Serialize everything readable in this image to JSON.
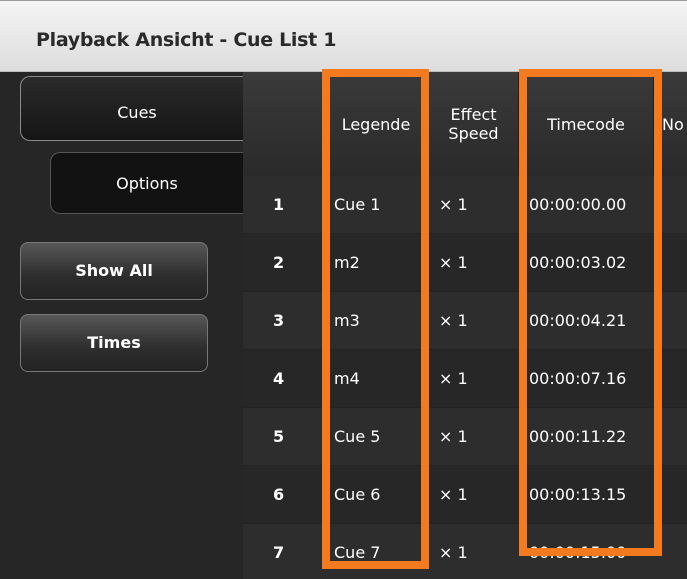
{
  "window": {
    "title": "Playback Ansicht - Cue List 1"
  },
  "left_panel": {
    "tabs": [
      {
        "label": "Cues"
      },
      {
        "label": "Options"
      }
    ],
    "buttons": [
      {
        "label": "Show All"
      },
      {
        "label": "Times"
      }
    ]
  },
  "table": {
    "headers": {
      "number": "",
      "legende": "Legende",
      "effect_speed": "Effect Speed",
      "timecode": "Timecode",
      "next": "No"
    },
    "rows": [
      {
        "num": "1",
        "legende": "Cue 1",
        "speed": "× 1",
        "timecode": "00:00:00.00"
      },
      {
        "num": "2",
        "legende": "m2",
        "speed": "× 1",
        "timecode": "00:00:03.02"
      },
      {
        "num": "3",
        "legende": "m3",
        "speed": "× 1",
        "timecode": "00:00:04.21"
      },
      {
        "num": "4",
        "legende": "m4",
        "speed": "× 1",
        "timecode": "00:00:07.16"
      },
      {
        "num": "5",
        "legende": "Cue 5",
        "speed": "× 1",
        "timecode": "00:00:11.22"
      },
      {
        "num": "6",
        "legende": "Cue 6",
        "speed": "× 1",
        "timecode": "00:00:13.15"
      },
      {
        "num": "7",
        "legende": "Cue 7",
        "speed": "× 1",
        "timecode": "00:00:15.00"
      }
    ]
  },
  "colors": {
    "highlight": "#f47a20",
    "background": "#2c2c2c",
    "title_bar": "#e6e6e6"
  }
}
